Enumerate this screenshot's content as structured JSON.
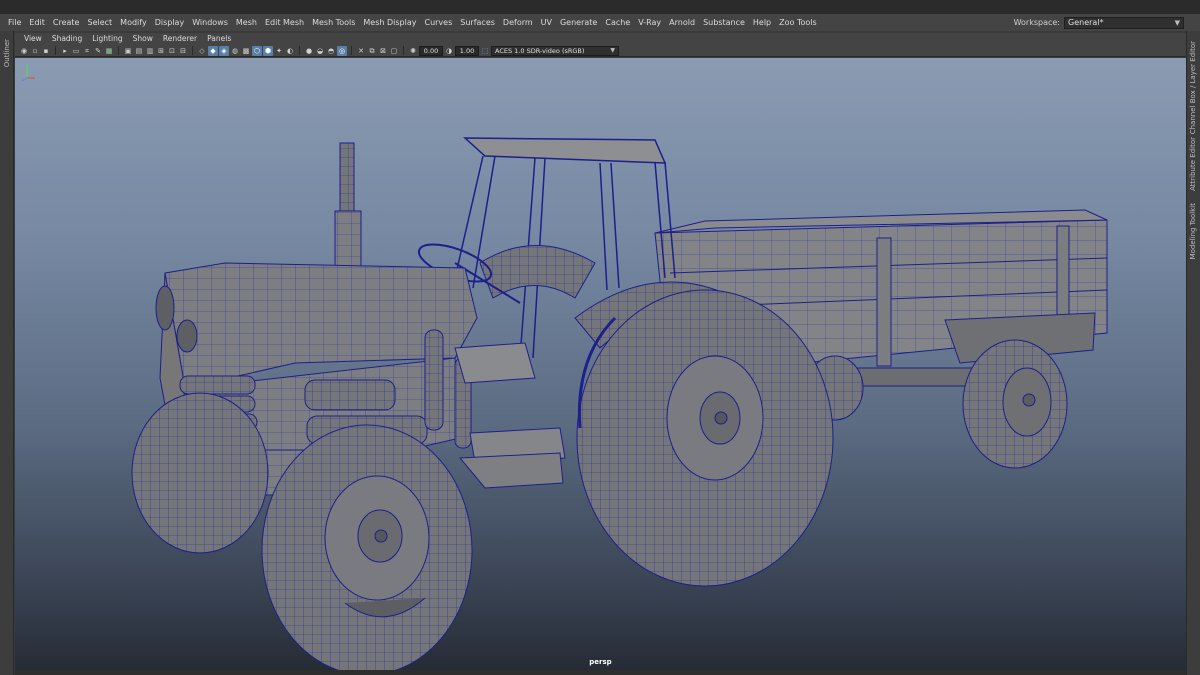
{
  "menu": {
    "items": [
      "File",
      "Edit",
      "Create",
      "Select",
      "Modify",
      "Display",
      "Windows",
      "Mesh",
      "Edit Mesh",
      "Mesh Tools",
      "Mesh Display",
      "Curves",
      "Surfaces",
      "Deform",
      "UV",
      "Generate",
      "Cache",
      "V-Ray",
      "Arnold",
      "Substance",
      "Help",
      "Zoo Tools"
    ],
    "workspace_label": "Workspace:",
    "workspace_value": "General*"
  },
  "left_tabs": {
    "outliner": "Outliner"
  },
  "right_tabs": {
    "channel_box": "Channel Box / Layer Editor",
    "attribute_editor": "Attribute Editor",
    "modeling_toolkit": "Modeling Toolkit"
  },
  "panel": {
    "menus": [
      "View",
      "Shading",
      "Lighting",
      "Show",
      "Renderer",
      "Panels"
    ]
  },
  "toolbar": {
    "exposure": "0.00",
    "gamma": "1.00",
    "color_space": "ACES 1.0 SDR-video (sRGB)"
  },
  "viewport": {
    "camera": "persp"
  },
  "colors": {
    "wire": "#1d20a0",
    "mesh": "#7b7b7d",
    "active_icon": "#5a7fa6"
  }
}
